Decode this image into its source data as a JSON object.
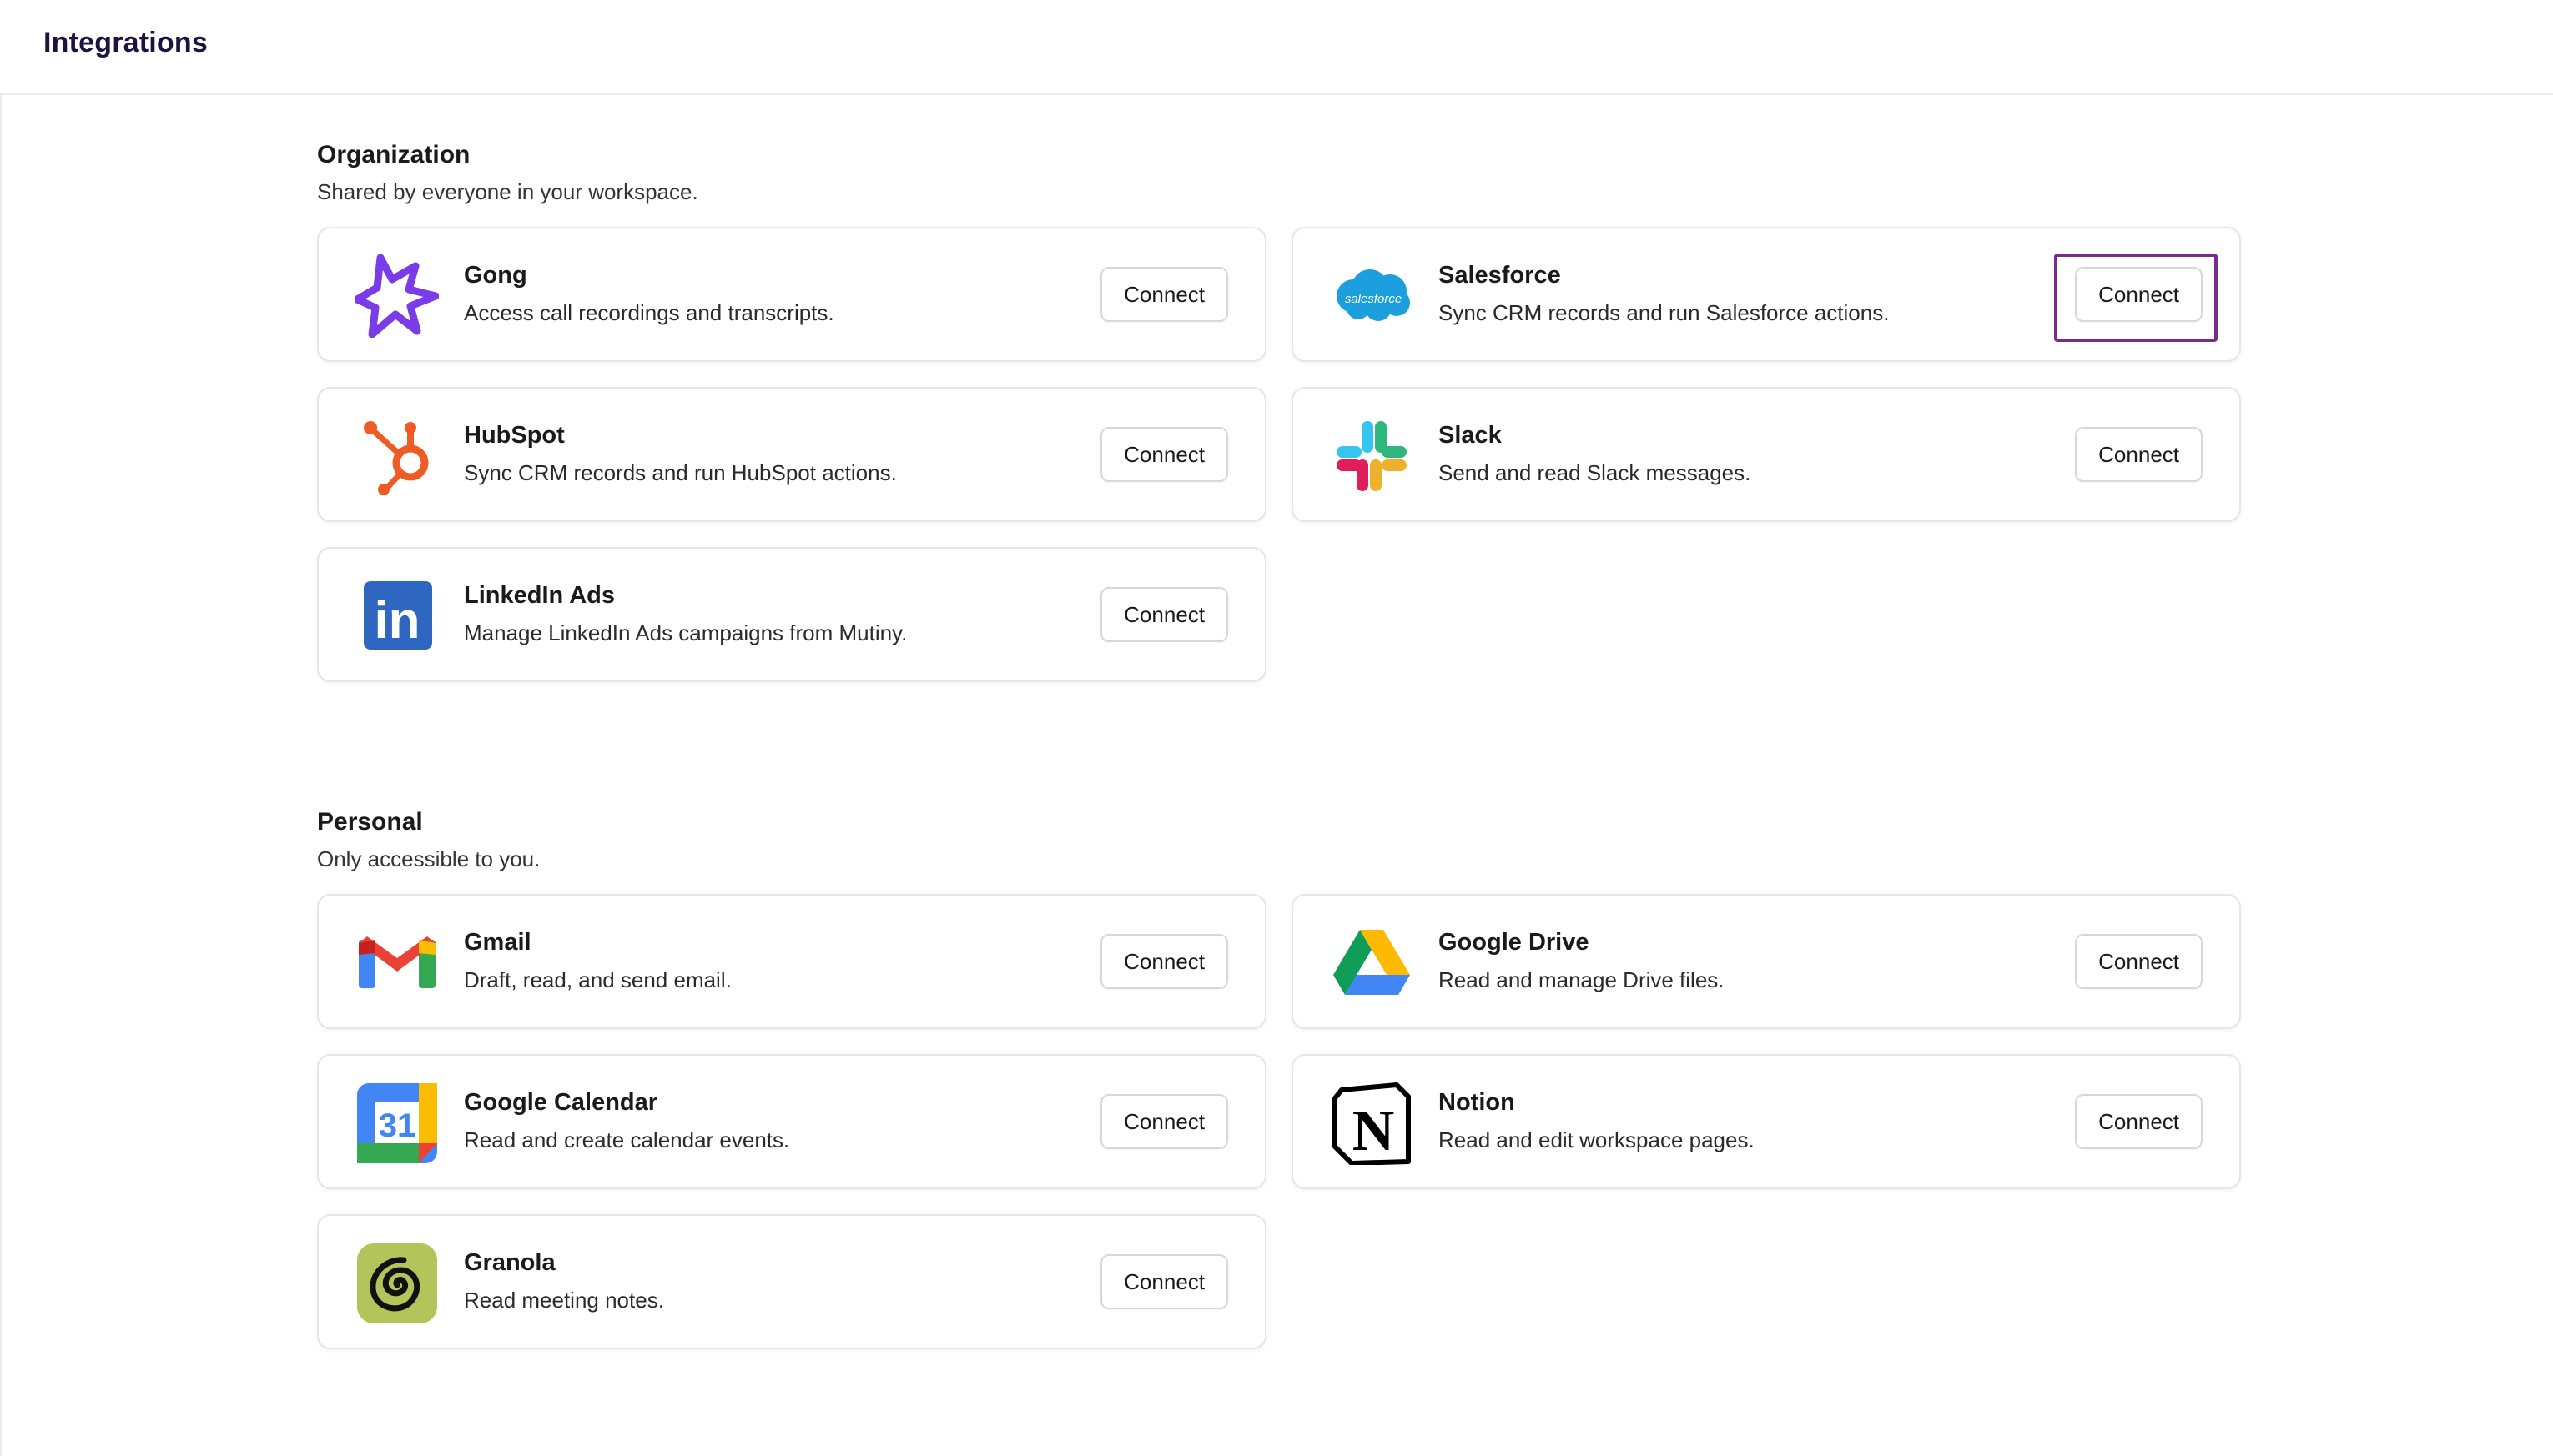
{
  "header": {
    "title": "Integrations"
  },
  "organization": {
    "title": "Organization",
    "subtitle": "Shared by everyone in your workspace.",
    "items": [
      {
        "name": "Gong",
        "description": "Access call recordings and transcripts.",
        "button": "Connect",
        "icon": "gong-icon"
      },
      {
        "name": "Salesforce",
        "description": "Sync CRM records and run Salesforce actions.",
        "button": "Connect",
        "icon": "salesforce-icon",
        "logo_text": "salesforce"
      },
      {
        "name": "HubSpot",
        "description": "Sync CRM records and run HubSpot actions.",
        "button": "Connect",
        "icon": "hubspot-icon"
      },
      {
        "name": "Slack",
        "description": "Send and read Slack messages.",
        "button": "Connect",
        "icon": "slack-icon"
      },
      {
        "name": "LinkedIn Ads",
        "description": "Manage LinkedIn Ads campaigns from Mutiny.",
        "button": "Connect",
        "icon": "linkedin-icon",
        "logo_text": "in"
      }
    ]
  },
  "personal": {
    "title": "Personal",
    "subtitle": "Only accessible to you.",
    "items": [
      {
        "name": "Gmail",
        "description": "Draft, read, and send email.",
        "button": "Connect",
        "icon": "gmail-icon"
      },
      {
        "name": "Google Drive",
        "description": "Read and manage Drive files.",
        "button": "Connect",
        "icon": "google-drive-icon"
      },
      {
        "name": "Google Calendar",
        "description": "Read and create calendar events.",
        "button": "Connect",
        "icon": "google-calendar-icon",
        "logo_text": "31"
      },
      {
        "name": "Notion",
        "description": "Read and edit workspace pages.",
        "button": "Connect",
        "icon": "notion-icon",
        "logo_text": "N"
      },
      {
        "name": "Granola",
        "description": "Read meeting notes.",
        "button": "Connect",
        "icon": "granola-icon"
      }
    ]
  },
  "colors": {
    "title": "#1e1240",
    "focus_ring": "#7b2a8e",
    "gong": "#7a3be8",
    "salesforce": "#1b9fdf",
    "hubspot": "#ef5b25",
    "linkedin": "#2f67c0",
    "granola": "#b3c45a"
  }
}
